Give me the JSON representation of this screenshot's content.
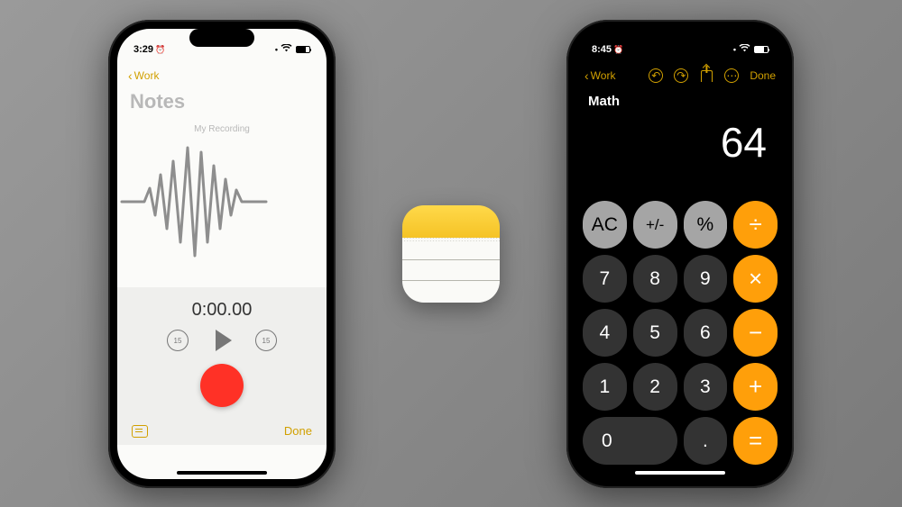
{
  "left_phone": {
    "status_time": "3:29",
    "nav_back": "Work",
    "page_title": "Notes",
    "recording_name": "My Recording",
    "timecode": "0:00.00",
    "skip_back": "15",
    "skip_fwd": "15",
    "done_label": "Done"
  },
  "right_phone": {
    "status_time": "8:45",
    "nav_back": "Work",
    "done_label": "Done",
    "page_title": "Math",
    "display_value": "64",
    "keys": {
      "ac": "AC",
      "plusminus": "+/-",
      "percent": "%",
      "divide": "÷",
      "k7": "7",
      "k8": "8",
      "k9": "9",
      "multiply": "×",
      "k4": "4",
      "k5": "5",
      "k6": "6",
      "minus": "−",
      "k1": "1",
      "k2": "2",
      "k3": "3",
      "plus": "+",
      "k0": "0",
      "decimal": ".",
      "equals": "="
    }
  }
}
